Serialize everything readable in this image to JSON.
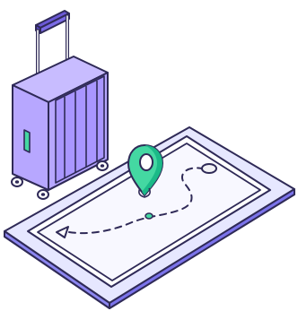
{
  "colors": {
    "outline": "#2f2a57",
    "suitcase_fill": "#b7a7ff",
    "suitcase_side": "#8f7af0",
    "suitcase_dark": "#6a55d6",
    "handle": "#6b59d6",
    "handle_grip": "#7b6be6",
    "phone_base": "#cfd1ff",
    "phone_border": "#8c86f1",
    "phone_screen": "#ffffff",
    "phone_screen_inner": "#f6f7ff",
    "pin_fill": "#44d8a2",
    "pin_dark": "#19b887",
    "pin_hole": "#ffffff",
    "route_dot": "#44d8a2",
    "destination_fill": "#f2f2f6",
    "path_line": "#2f2a57"
  },
  "icons": {
    "suitcase": "suitcase-icon",
    "map_pin": "map-pin-icon",
    "navigation_arrow": "navigation-arrow-icon",
    "destination": "destination-icon"
  }
}
